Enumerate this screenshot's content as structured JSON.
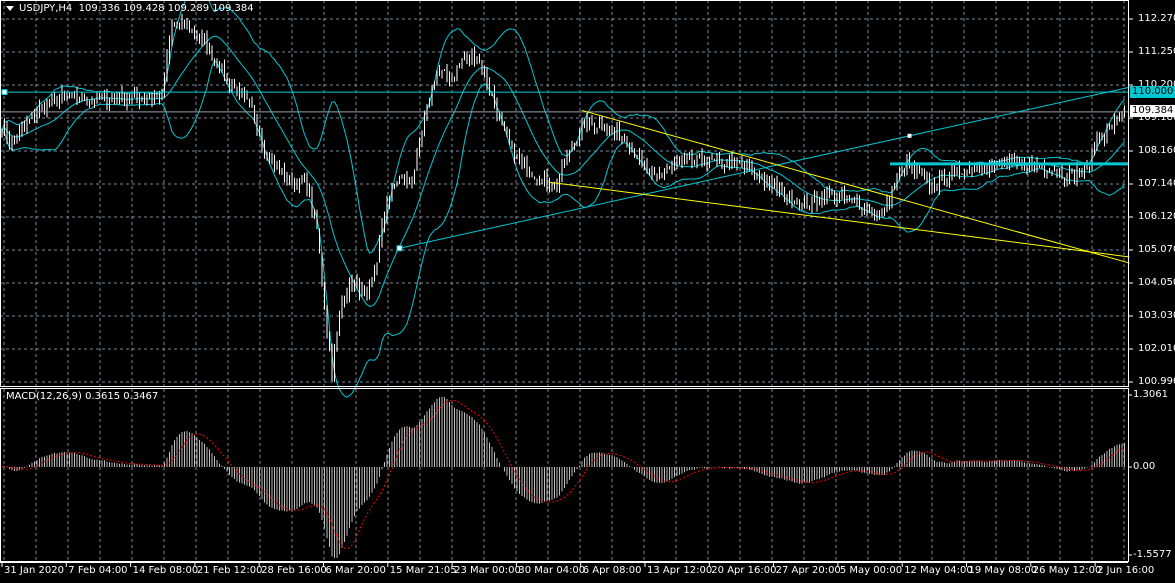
{
  "header": {
    "symbol": "USDJPY,H4",
    "ohlc": "109.336 109.428 109.289 109.384"
  },
  "macd_header": {
    "label": "MACD(12,26,9) 0.3615 0.3467"
  },
  "price_axis": [
    "112.270",
    "111.250",
    "110.200",
    "109.180",
    "108.160",
    "107.140",
    "106.120",
    "105.070",
    "104.050",
    "103.030",
    "102.010",
    "100.990"
  ],
  "macd_axis": [
    "1.3061",
    "0.00",
    "-1.5577"
  ],
  "time_axis": [
    "31 Jan 2020",
    "7 Feb 04:00",
    "14 Feb 08:00",
    "21 Feb 12:00",
    "28 Feb 16:00",
    "6 Mar 20:00",
    "15 Mar 21:05",
    "23 Mar 00:00",
    "30 Mar 04:00",
    "6 Apr 08:00",
    "13 Apr 12:00",
    "20 Apr 16:00",
    "27 Apr 20:00",
    "5 May 00:00",
    "12 May 04:00",
    "19 May 08:00",
    "26 May 12:00",
    "2 Jun 16:00"
  ],
  "markers": {
    "hline_level": "110.000",
    "current_price": "109.384"
  },
  "colors": {
    "background": "#000000",
    "grid": "#778899",
    "bars": "#ffffff",
    "bands": "#00c8d2",
    "hline": "#00c8d2",
    "trend_yellow": "#ffff00",
    "macd_hist": "#c0c0c0",
    "macd_signal": "#ff0000"
  },
  "chart_data": {
    "type": "line",
    "title": "USDJPY,H4",
    "ylim": [
      100.99,
      112.27
    ],
    "bars_count": 450,
    "close_anchors": [
      [
        0,
        108.98
      ],
      [
        4,
        108.36
      ],
      [
        14,
        109.44
      ],
      [
        24,
        109.82
      ],
      [
        40,
        109.78
      ],
      [
        64,
        109.85
      ],
      [
        68,
        112.08
      ],
      [
        74,
        112.08
      ],
      [
        82,
        111.46
      ],
      [
        90,
        110.38
      ],
      [
        100,
        109.44
      ],
      [
        106,
        108.05
      ],
      [
        114,
        107.27
      ],
      [
        122,
        107.11
      ],
      [
        126,
        105.72
      ],
      [
        130,
        102.61
      ],
      [
        132,
        101.37
      ],
      [
        136,
        103.54
      ],
      [
        140,
        104.16
      ],
      [
        146,
        103.54
      ],
      [
        150,
        104.79
      ],
      [
        154,
        106.65
      ],
      [
        158,
        107.27
      ],
      [
        164,
        107.27
      ],
      [
        170,
        109.44
      ],
      [
        174,
        110.69
      ],
      [
        180,
        110.38
      ],
      [
        184,
        111.0
      ],
      [
        190,
        111.15
      ],
      [
        196,
        109.91
      ],
      [
        200,
        108.98
      ],
      [
        204,
        108.2
      ],
      [
        208,
        107.74
      ],
      [
        216,
        107.27
      ],
      [
        222,
        107.11
      ],
      [
        224,
        107.58
      ],
      [
        232,
        108.98
      ],
      [
        240,
        108.98
      ],
      [
        250,
        108.51
      ],
      [
        260,
        107.27
      ],
      [
        268,
        107.74
      ],
      [
        280,
        107.89
      ],
      [
        296,
        107.74
      ],
      [
        308,
        107.11
      ],
      [
        320,
        106.49
      ],
      [
        332,
        106.8
      ],
      [
        344,
        106.49
      ],
      [
        352,
        106.18
      ],
      [
        358,
        107.27
      ],
      [
        362,
        107.74
      ],
      [
        372,
        107.11
      ],
      [
        384,
        107.58
      ],
      [
        396,
        107.74
      ],
      [
        416,
        107.74
      ],
      [
        426,
        107.42
      ],
      [
        434,
        107.58
      ],
      [
        438,
        108.51
      ],
      [
        444,
        108.98
      ],
      [
        449,
        109.384
      ]
    ],
    "indicators": {
      "bollinger": {
        "period": 20,
        "deviation": 2
      },
      "macd": {
        "fast": 12,
        "slow": 26,
        "signal": 9,
        "ylim": [
          -1.5577,
          1.3061
        ]
      }
    },
    "horizontal_lines": [
      110.0,
      107.77
    ],
    "trendlines": [
      {
        "color": "cyan",
        "from": [
          159,
          105.15
        ],
        "to": [
          451,
          110.15
        ]
      },
      {
        "color": "yellow",
        "from": [
          232,
          109.43
        ],
        "to": [
          451,
          104.69
        ]
      },
      {
        "color": "yellow",
        "from": [
          219,
          107.2
        ],
        "to": [
          451,
          104.88
        ]
      }
    ]
  }
}
